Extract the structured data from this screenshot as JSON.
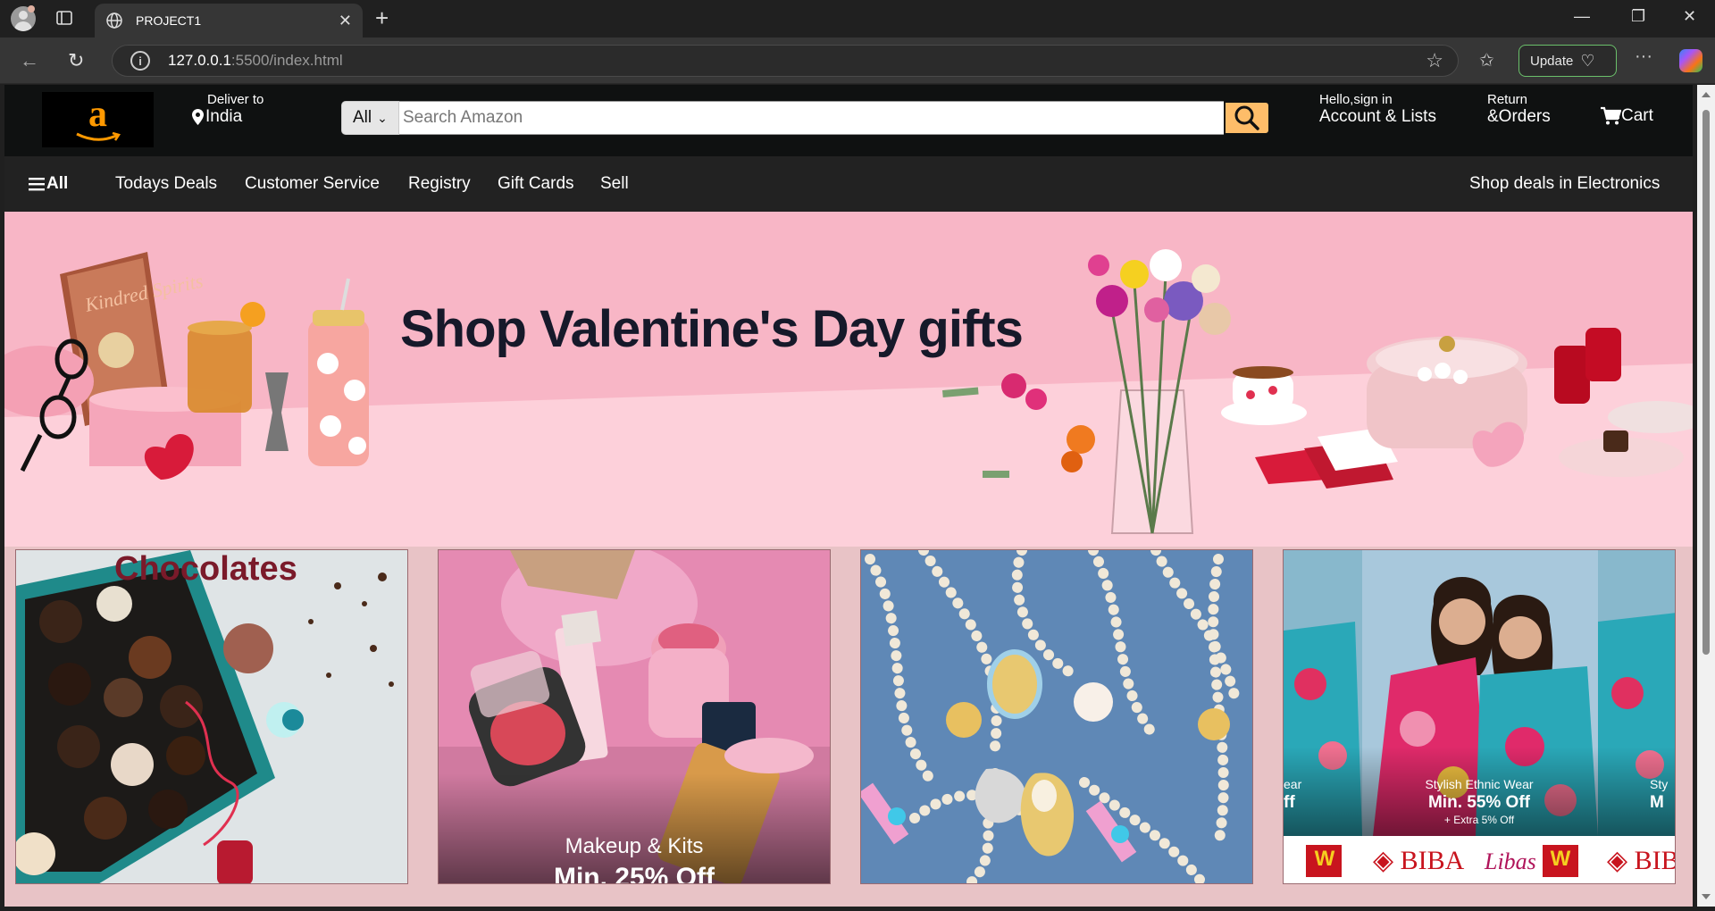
{
  "browser": {
    "tab_title": "PROJECT1",
    "url_host": "127.0.0.1",
    "url_path": ":5500/index.html",
    "update_label": "Update"
  },
  "header": {
    "logo_letter": "a",
    "deliver_small": "Deliver to",
    "deliver_location": "India",
    "search_category": "All",
    "search_placeholder": "Search Amazon",
    "account_small": "Hello,sign in",
    "account_big": "Account & Lists",
    "returns_small": "Return",
    "returns_big": "&Orders",
    "cart_label": "Cart"
  },
  "nav": {
    "all_label": "All",
    "items": [
      "Todays Deals",
      "Customer Service",
      "Registry",
      "Gift Cards",
      "Sell"
    ],
    "right_label": "Shop deals in Electronics"
  },
  "hero": {
    "headline": "Shop Valentine's Day gifts",
    "book_title": "Kindred Spirits"
  },
  "cards": [
    {
      "title": "Chocolates"
    },
    {
      "caption": "Makeup & Kits",
      "subcaption": "Min. 25% Off"
    },
    {
      "caption": ""
    },
    {
      "caption_small": "Stylish Ethnic Wear",
      "caption_big": "Min. 55% Off",
      "caption_extra": "+ Extra 5% Off",
      "brands": [
        "W",
        "BIBA",
        "Libas",
        "W",
        "BIB"
      ],
      "left_partial_small": "ear",
      "left_partial_big": "ff",
      "right_partial_small": "Sty",
      "right_partial_big": "M"
    }
  ],
  "colors": {
    "amazon_dark": "#0f1111",
    "nav_dark": "#222222",
    "search_button": "#febd69",
    "logo_orange": "#ff9900",
    "hero_pink": "#f8b6c6",
    "page_bg": "#e8c3c6"
  }
}
